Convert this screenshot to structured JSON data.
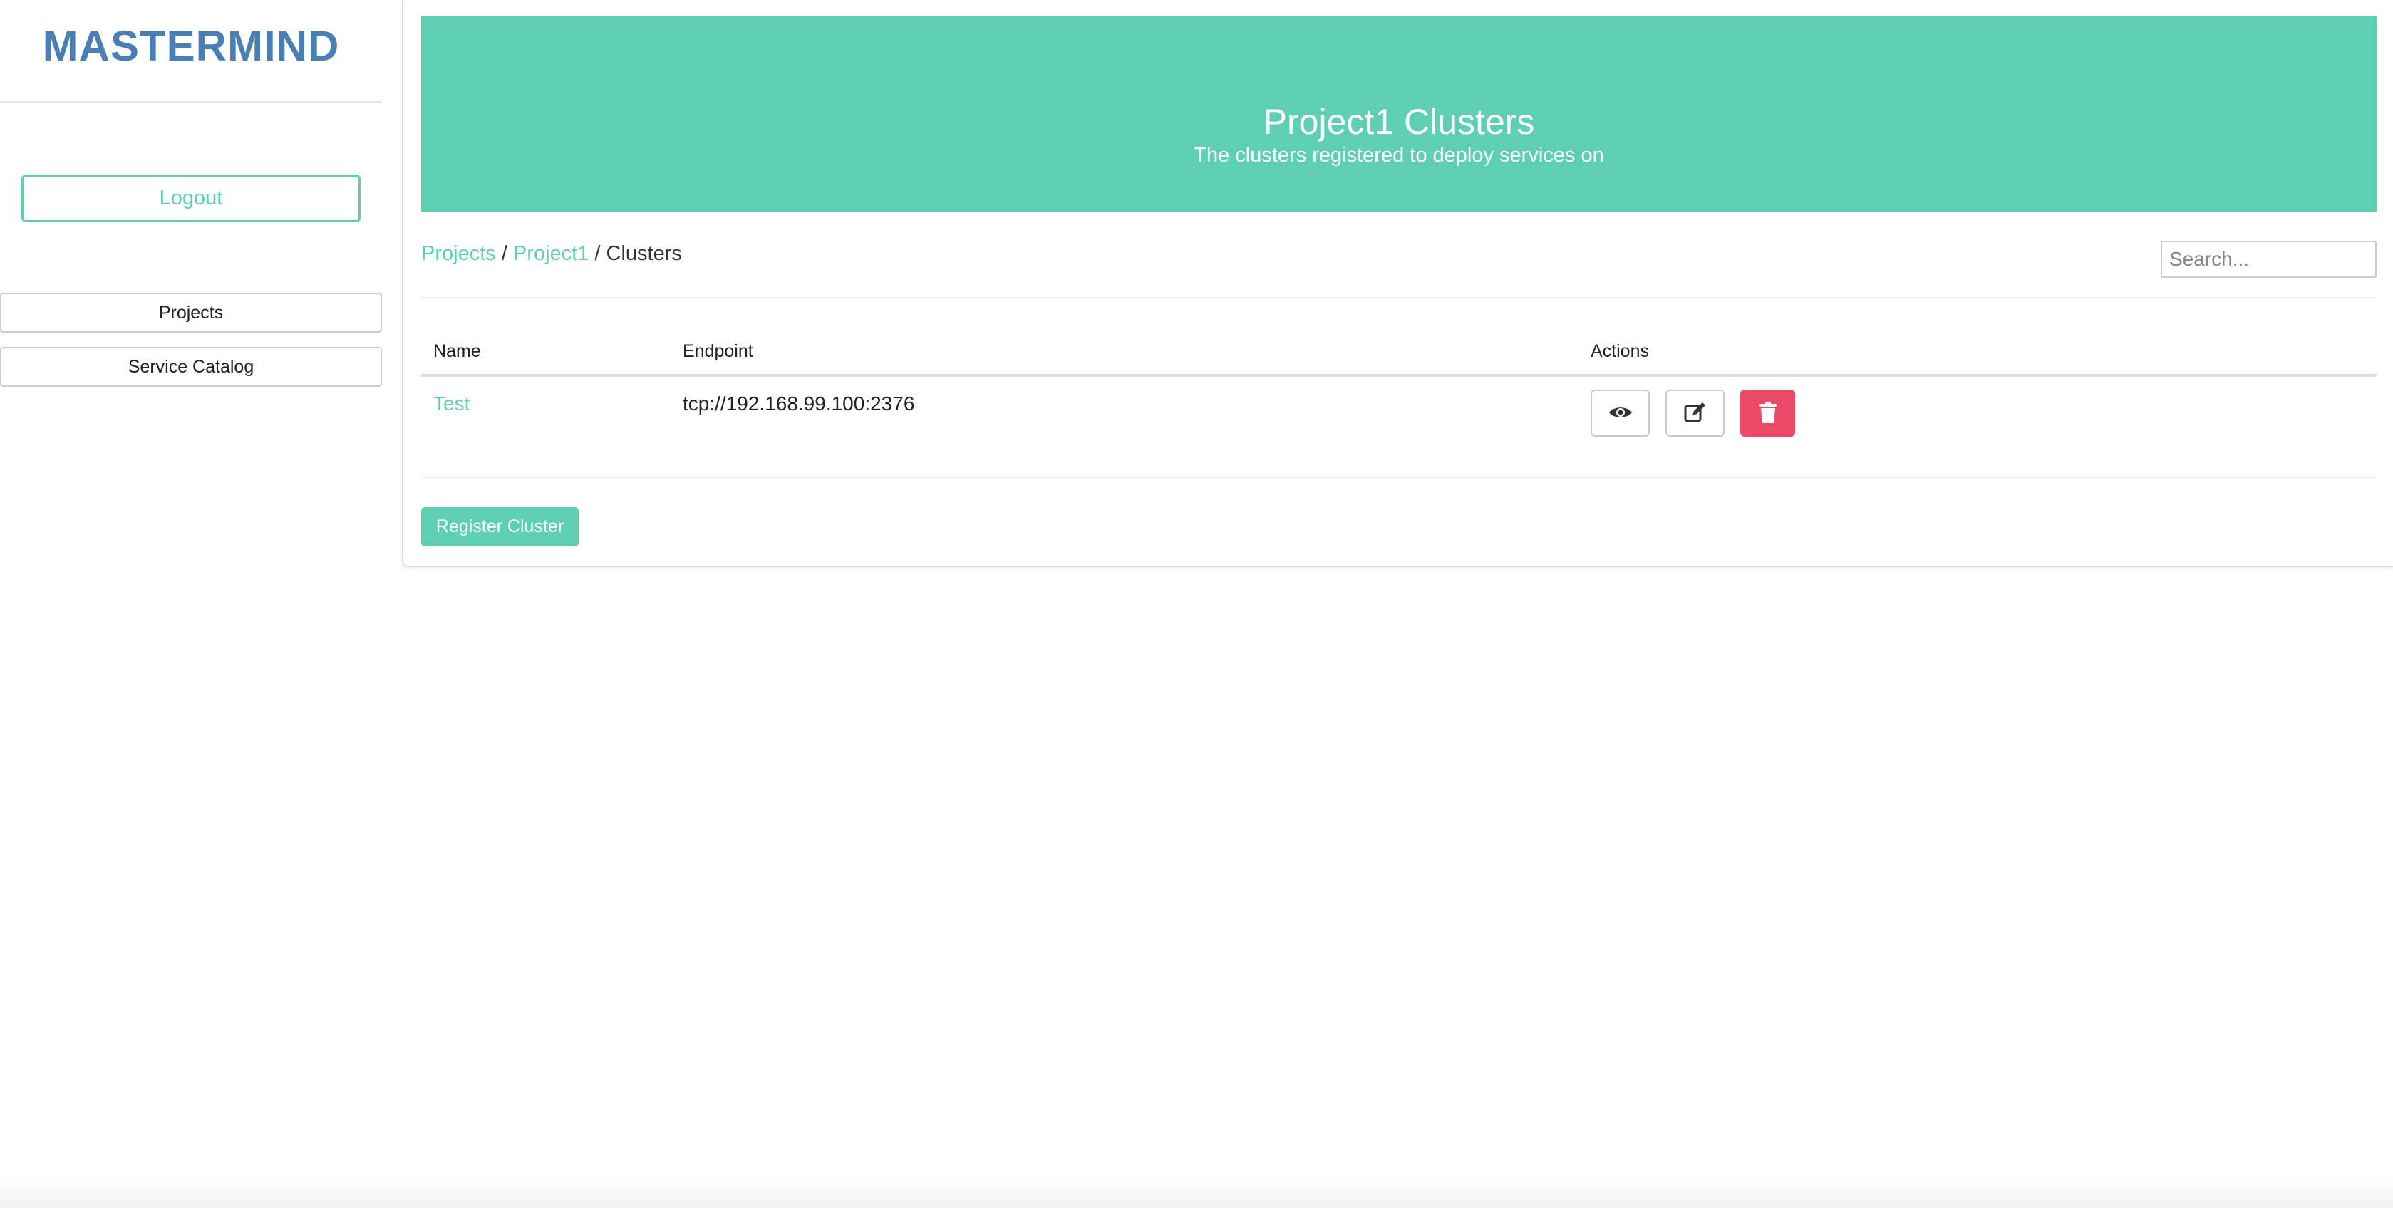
{
  "sidebar": {
    "brand": "MASTERMIND",
    "logout_label": "Logout",
    "nav": [
      {
        "label": "Projects"
      },
      {
        "label": "Service Catalog"
      }
    ]
  },
  "hero": {
    "title": "Project1 Clusters",
    "subtitle": "The clusters registered to deploy services on"
  },
  "breadcrumb": {
    "items": [
      "Projects",
      "Project1",
      "Clusters"
    ],
    "separator": "/"
  },
  "search": {
    "placeholder": "Search..."
  },
  "table": {
    "columns": [
      "Name",
      "Endpoint",
      "Actions"
    ],
    "rows": [
      {
        "name": "Test",
        "endpoint": "tcp://192.168.99.100:2376"
      }
    ]
  },
  "register_label": "Register Cluster",
  "icons": {
    "view": "eye-icon",
    "edit": "edit-icon",
    "delete": "trash-icon"
  },
  "colors": {
    "accent": "#5ecfb3",
    "brand": "#4a7fb5",
    "danger": "#ec4b67"
  }
}
